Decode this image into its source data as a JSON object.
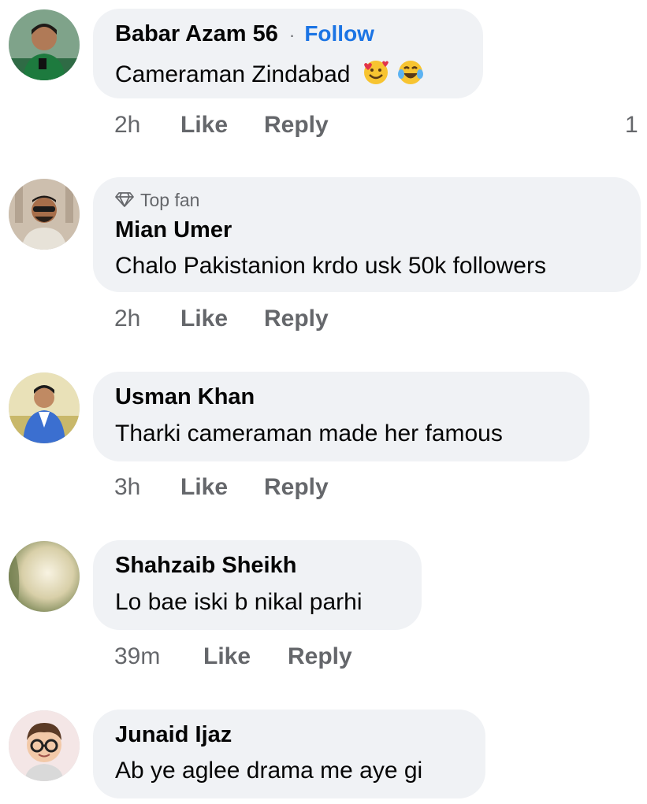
{
  "comments": [
    {
      "author": "Babar Azam 56",
      "follow_label": "Follow",
      "separator": "·",
      "text": "Cameraman Zindabad",
      "emojis": [
        "smiling-face-with-hearts-icon",
        "face-with-tears-of-joy-icon"
      ],
      "time": "2h",
      "like_label": "Like",
      "reply_label": "Reply",
      "reaction_count": "1"
    },
    {
      "badge": "Top fan",
      "author": "Mian Umer",
      "text": "Chalo Pakistanion krdo usk 50k followers",
      "time": "2h",
      "like_label": "Like",
      "reply_label": "Reply"
    },
    {
      "author": "Usman Khan",
      "text": "Tharki cameraman made her famous",
      "time": "3h",
      "like_label": "Like",
      "reply_label": "Reply"
    },
    {
      "author": "Shahzaib Sheikh",
      "text": "Lo bae iski b nikal parhi",
      "time": "39m",
      "like_label": "Like",
      "reply_label": "Reply"
    },
    {
      "author": "Junaid Ijaz",
      "text": "Ab ye aglee drama me aye gi"
    }
  ],
  "colors": {
    "bubble": "#f0f2f5",
    "link": "#1b74e4",
    "secondary_text": "#65676b"
  }
}
